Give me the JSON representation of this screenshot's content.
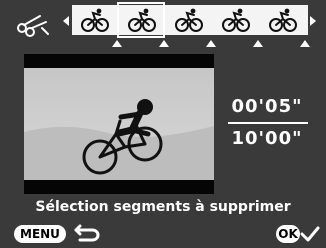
{
  "filmstrip": {
    "frame_count": 5,
    "selected_frame": 2,
    "marker_frames": [
      1,
      2,
      3,
      4,
      5
    ]
  },
  "time": {
    "current": "00'05\"",
    "total": "10'00\""
  },
  "caption": "Sélection segments à supprimer",
  "buttons": {
    "menu_label": "MENU",
    "ok_label": "OK"
  },
  "icons": {
    "top_left": "scissors-icon",
    "back": "return-arrow-icon",
    "confirm": "checkmark-icon"
  }
}
